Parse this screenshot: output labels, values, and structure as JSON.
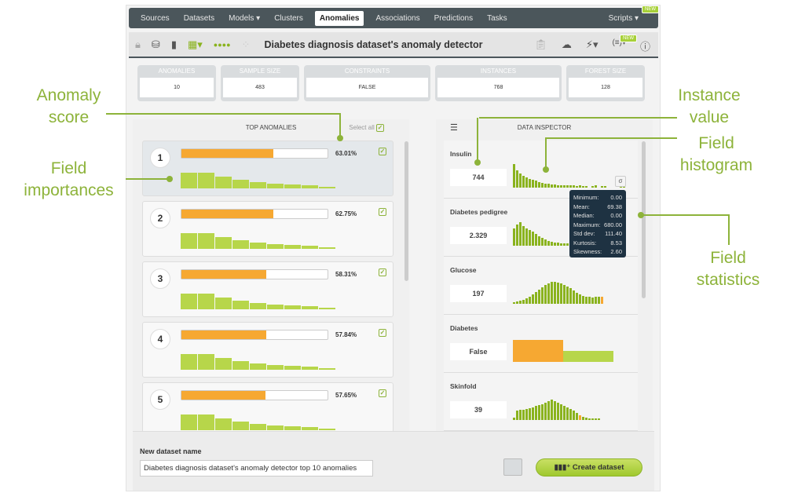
{
  "nav": {
    "items": [
      "Sources",
      "Datasets",
      "Models ▾",
      "Clusters",
      "Anomalies",
      "Associations",
      "Predictions",
      "Tasks"
    ],
    "active": "Anomalies",
    "scripts": "Scripts ▾",
    "new_badge": "NEW"
  },
  "toolbar": {
    "title": "Diabetes diagnosis dataset's anomaly detector",
    "new_badge": "NEW"
  },
  "stats": [
    {
      "label": "ANOMALIES",
      "value": "10"
    },
    {
      "label": "SAMPLE SIZE",
      "value": "483"
    },
    {
      "label": "CONSTRAINTS",
      "value": "FALSE"
    },
    {
      "label": "INSTANCES",
      "value": "768"
    },
    {
      "label": "FOREST SIZE",
      "value": "128"
    }
  ],
  "top_anomalies": {
    "title": "TOP ANOMALIES",
    "select_all": "Select all",
    "items": [
      {
        "rank": "1",
        "score": "63.01%",
        "score_value": 63.01
      },
      {
        "rank": "2",
        "score": "62.75%",
        "score_value": 62.75
      },
      {
        "rank": "3",
        "score": "58.31%",
        "score_value": 58.31
      },
      {
        "rank": "4",
        "score": "57.84%",
        "score_value": 57.84
      },
      {
        "rank": "5",
        "score": "57.65%",
        "score_value": 57.65
      }
    ]
  },
  "inspector": {
    "title": "DATA INSPECTOR",
    "fields": [
      {
        "name": "Insulin",
        "value": "744"
      },
      {
        "name": "Diabetes pedigree",
        "value": "2.329"
      },
      {
        "name": "Glucose",
        "value": "197"
      },
      {
        "name": "Diabetes",
        "value": "False"
      },
      {
        "name": "Skinfold",
        "value": "39"
      }
    ],
    "stats_button": "σ",
    "tooltip": [
      {
        "k": "Minimum:",
        "v": "0.00"
      },
      {
        "k": "Mean:",
        "v": "69.38"
      },
      {
        "k": "Median:",
        "v": "0.00"
      },
      {
        "k": "Maximum:",
        "v": "680.00"
      },
      {
        "k": "Std dev:",
        "v": "111.40"
      },
      {
        "k": "Kurtosis:",
        "v": "8.53"
      },
      {
        "k": "Skewness:",
        "v": "2.60"
      }
    ]
  },
  "footer": {
    "label": "New dataset name",
    "input_value": "Diabetes diagnosis dataset's anomaly detector top 10 anomalies",
    "create": "Create dataset"
  },
  "annotations": {
    "anomaly_score": "Anomaly score",
    "field_importances": "Field importances",
    "instance_value": "Instance value",
    "field_histogram": "Field histogram",
    "field_statistics": "Field statistics"
  },
  "colors": {
    "accent": "#8db33a",
    "score_bar": "#f6a832",
    "histogram": "#8ab31e",
    "nav": "#4b565b"
  }
}
